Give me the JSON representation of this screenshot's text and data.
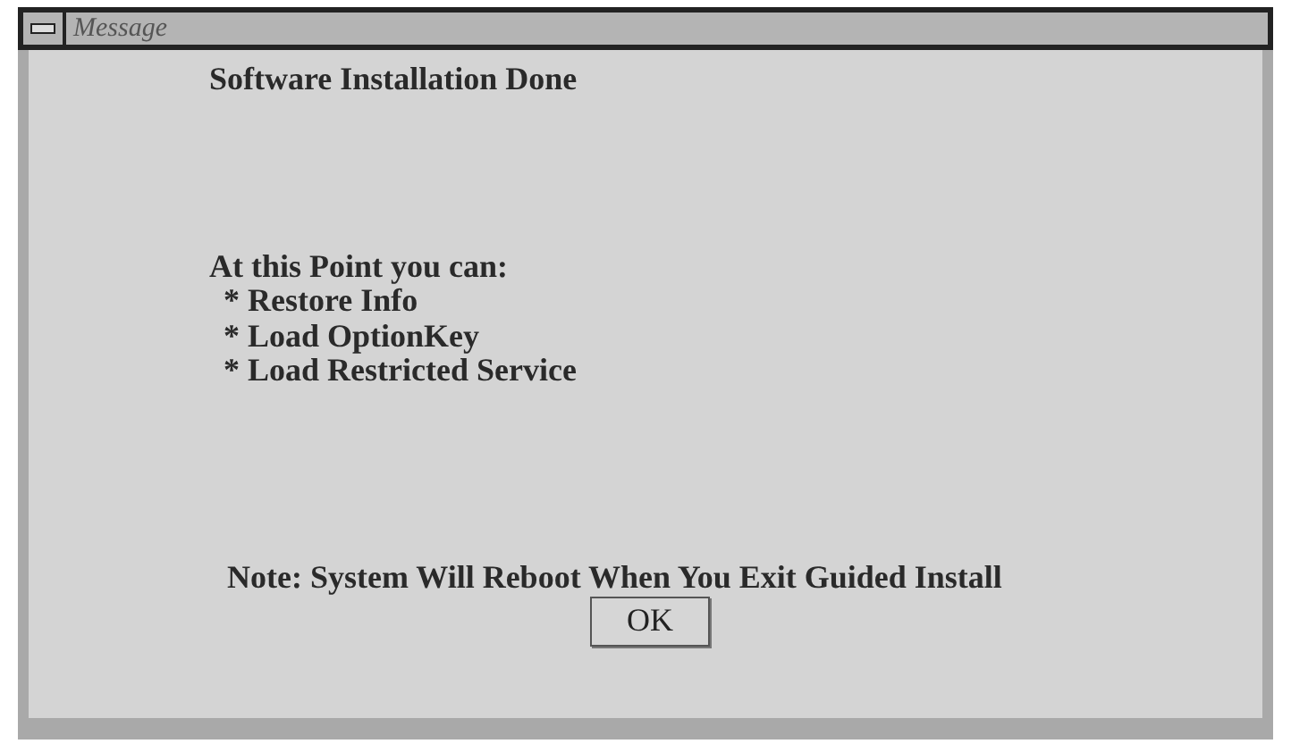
{
  "window": {
    "title": "Message"
  },
  "heading": "Software Installation Done",
  "intro": "At this Point you can:",
  "options": [
    "* Restore Info",
    "* Load OptionKey",
    "* Load Restricted Service"
  ],
  "note": "Note: System Will Reboot When You Exit Guided Install",
  "buttons": [
    "OK"
  ]
}
